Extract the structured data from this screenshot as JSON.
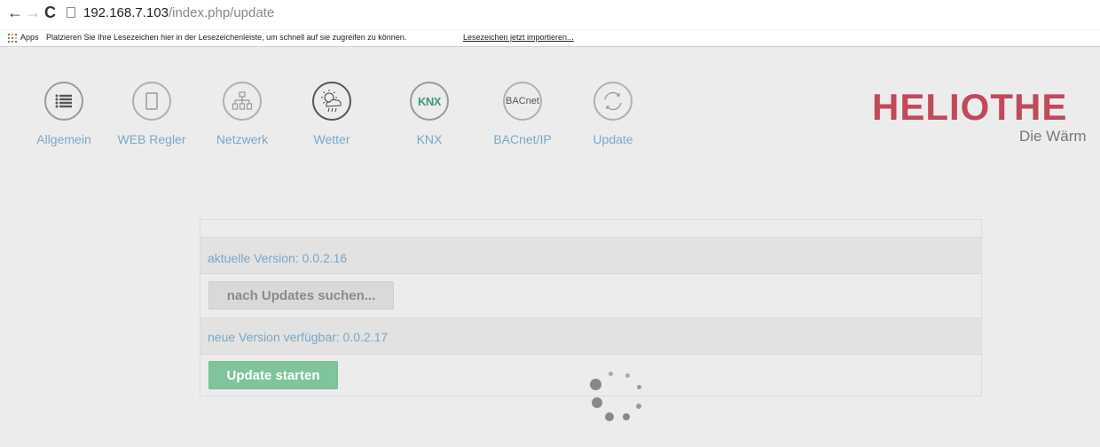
{
  "browser": {
    "url_host": "192.168.7.103",
    "url_path": "/index.php/update",
    "bookmarks": {
      "apps_label": "Apps",
      "hint": "Platzieren Sie Ihre Lesezeichen hier in der Lesezeichenleiste, um schnell auf sie zugreifen zu können.",
      "import_link": "Lesezeichen jetzt importieren..."
    }
  },
  "nav": {
    "items": [
      {
        "label": "Allgemein",
        "icon": "list-icon"
      },
      {
        "label": "WEB Regler",
        "icon": "device-icon"
      },
      {
        "label": "Netzwerk",
        "icon": "network-icon"
      },
      {
        "label": "Wetter",
        "icon": "weather-icon"
      },
      {
        "label": "KNX",
        "icon": "knx-icon",
        "icon_text": "KNX"
      },
      {
        "label": "BACnet/IP",
        "icon": "bacnet-icon",
        "icon_text": "BACnet"
      },
      {
        "label": "Update",
        "icon": "refresh-icon"
      }
    ]
  },
  "brand": {
    "name": "HELIOTHE",
    "tagline": "Die Wärm"
  },
  "update": {
    "current_version": "aktuelle Version: 0.0.2.16",
    "search_button": "nach Updates suchen...",
    "new_version": "neue Version verfügbar: 0.0.2.17",
    "start_button": "Update starten"
  },
  "colors": {
    "accent_text": "#7aa7c6",
    "brand": "#c0495a",
    "start_button": "#7fc49a"
  }
}
